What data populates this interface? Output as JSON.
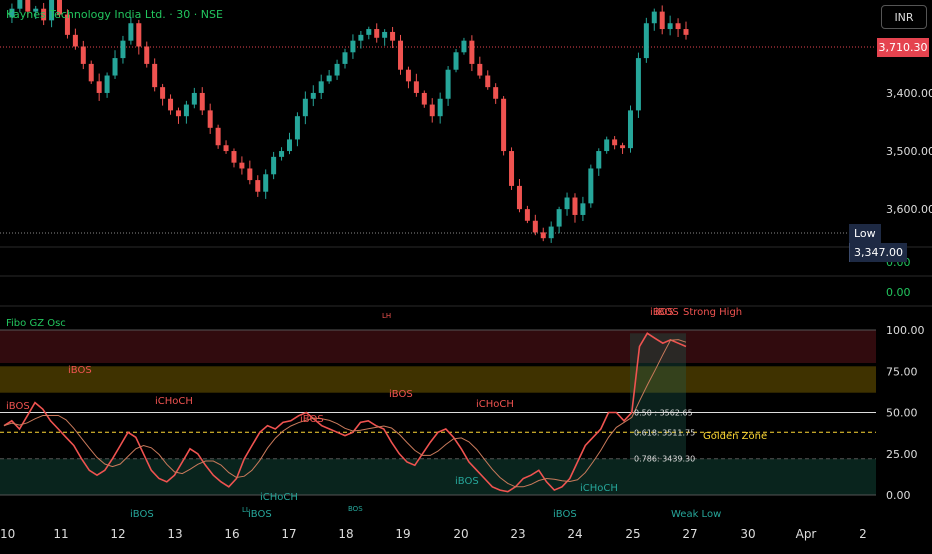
{
  "header": {
    "title": "Kaynes Technology India Ltd. · 30 · NSE",
    "currency": "INR",
    "last_price": "3,710.30",
    "low_label": "Low",
    "low_value": "3,347.00"
  },
  "price_axis": {
    "ticks": [
      "3,600.00",
      "3,500.00",
      "3,400.00"
    ],
    "ticks_values": [
      3600,
      3500,
      3400
    ]
  },
  "empty_panes": {
    "values": [
      "0.00",
      "0.00"
    ]
  },
  "oscillator": {
    "title": "Fibo GZ Osc",
    "ticks": [
      "100.00",
      "75.00",
      "50.00",
      "25.00",
      "0.00"
    ],
    "fib_labels": [
      "0.50 : 3562.65",
      "0.618: 3511.75",
      "0.786: 3439.30"
    ],
    "golden_zone": "Golden Zone",
    "strong_high": "Strong High",
    "weak_low": "Weak Low",
    "annotations": [
      "iBOS",
      "iBOS",
      "iCHoCH",
      "iBOS",
      "iBOS",
      "iCHoCH",
      "iBOS",
      "iBOS",
      "iBOS",
      "iCHoCH",
      "iBOS",
      "iCHoCH",
      "iBOS",
      "LH",
      "BOS",
      "LL",
      "iBOS"
    ]
  },
  "time_axis": {
    "labels": [
      "10",
      "11",
      "12",
      "13",
      "16",
      "17",
      "18",
      "19",
      "20",
      "23",
      "24",
      "25",
      "27",
      "30",
      "Apr",
      "2"
    ]
  },
  "colors": {
    "up": "#26a69a",
    "down": "#ef5350",
    "accent": "#22c55e",
    "price_tag": "#e5434f",
    "osc_line": "#fdd835"
  },
  "chart_data": [
    {
      "type": "candlestick",
      "title": "Kaynes Technology India Ltd. · 30 · NSE",
      "ylim": [
        3340,
        3760
      ],
      "yticks": [
        3400,
        3500,
        3600
      ],
      "last_price": 3710.3,
      "session_low": 3347.0,
      "x_labels": [
        "10",
        "11",
        "12",
        "13",
        "16",
        "17",
        "18",
        "19",
        "20",
        "23",
        "24",
        "25",
        "27",
        "30",
        "Apr",
        "2"
      ],
      "close_path": [
        3730,
        3745,
        3760,
        3740,
        3745,
        3725,
        3760,
        3735,
        3700,
        3680,
        3650,
        3620,
        3600,
        3630,
        3660,
        3690,
        3720,
        3680,
        3650,
        3610,
        3590,
        3570,
        3560,
        3580,
        3600,
        3570,
        3540,
        3510,
        3500,
        3480,
        3470,
        3450,
        3430,
        3460,
        3490,
        3500,
        3520,
        3560,
        3590,
        3600,
        3620,
        3630,
        3650,
        3670,
        3690,
        3700,
        3710,
        3695,
        3705,
        3690,
        3640,
        3620,
        3600,
        3580,
        3560,
        3590,
        3640,
        3670,
        3690,
        3650,
        3630,
        3610,
        3590,
        3500,
        3440,
        3400,
        3380,
        3360,
        3350,
        3370,
        3400,
        3420,
        3390,
        3410,
        3470,
        3500,
        3520,
        3510,
        3505,
        3570,
        3660,
        3720,
        3740,
        3710,
        3720,
        3710,
        3700
      ],
      "ohlc_sample": [
        {
          "t": "11",
          "o": 3740,
          "h": 3760,
          "c": 3750,
          "l": 3720
        },
        {
          "t": "12",
          "o": 3700,
          "h": 3710,
          "c": 3600,
          "l": 3580
        },
        {
          "t": "16",
          "o": 3480,
          "h": 3500,
          "c": 3450,
          "l": 3420
        },
        {
          "t": "18",
          "o": 3650,
          "h": 3700,
          "c": 3690,
          "l": 3640
        },
        {
          "t": "23",
          "o": 3420,
          "h": 3440,
          "c": 3360,
          "l": 3347
        },
        {
          "t": "25",
          "o": 3520,
          "h": 3720,
          "c": 3700,
          "l": 3510
        }
      ]
    },
    {
      "type": "line",
      "title": "Fibo GZ Osc",
      "ylim": [
        0,
        100
      ],
      "yticks": [
        0,
        25,
        50,
        75,
        100
      ],
      "series": [
        {
          "values": [
            42,
            45,
            40,
            48,
            56,
            52,
            45,
            40,
            35,
            30,
            22,
            15,
            12,
            15,
            22,
            30,
            38,
            35,
            25,
            15,
            10,
            8,
            12,
            20,
            28,
            25,
            18,
            12,
            8,
            5,
            10,
            22,
            30,
            38,
            42,
            40,
            44,
            45,
            48,
            50,
            46,
            42,
            40,
            38,
            36,
            38,
            44,
            45,
            42,
            40,
            32,
            25,
            20,
            18,
            25,
            32,
            38,
            40,
            35,
            28,
            20,
            15,
            10,
            5,
            3,
            2,
            5,
            10,
            12,
            15,
            8,
            3,
            5,
            10,
            20,
            30,
            35,
            40,
            50,
            50,
            45,
            50,
            90,
            98,
            95,
            92,
            94,
            92,
            90
          ]
        }
      ],
      "bands": [
        {
          "from": 80,
          "to": 100,
          "color": "#3a0d10"
        },
        {
          "from": 62,
          "to": 78,
          "color": "#4a3b00"
        },
        {
          "from": 0,
          "to": 22,
          "color": "#0a2a22"
        }
      ],
      "levels": [
        {
          "label": "0.50 : 3562.65",
          "value": 50
        },
        {
          "label": "0.618: 3511.75",
          "value": 38
        },
        {
          "label": "0.786: 3439.30",
          "value": 22
        }
      ]
    }
  ]
}
